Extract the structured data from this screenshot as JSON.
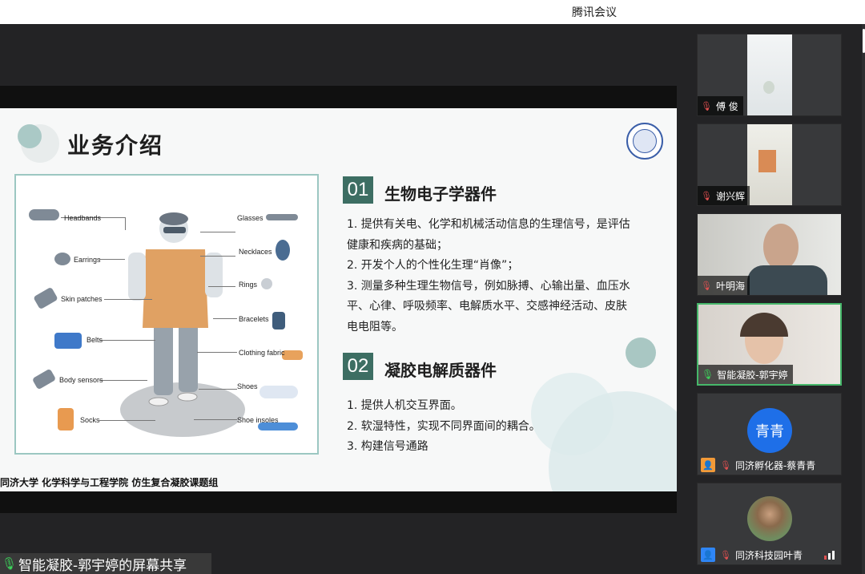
{
  "app": {
    "title": "腾讯会议"
  },
  "slide": {
    "title": "业务介绍",
    "footer": "同济大学 化学科学与工程学院 仿生复合凝胶课题组",
    "figure_labels": {
      "left": [
        "Headbands",
        "Earrings",
        "Skin patches",
        "Belts",
        "Body sensors",
        "Socks"
      ],
      "right": [
        "Glasses",
        "Necklaces",
        "Rings",
        "Bracelets",
        "Clothing fabric",
        "Shoes",
        "Shoe insoles"
      ]
    },
    "sections": [
      {
        "num": "01",
        "title": "生物电子学器件",
        "lines": [
          "1. 提供有关电、化学和机械活动信息的生理信号，是评估",
          "健康和疾病的基础；",
          "2. 开发个人的个性化生理“肖像”；",
          "3. 测量多种生理生物信号，例如脉搏、心输出量、血压水",
          "平、心律、呼吸频率、电解质水平、交感神经活动、皮肤",
          "电电阻等。"
        ]
      },
      {
        "num": "02",
        "title": "凝胶电解质器件",
        "lines": [
          "1.   提供人机交互界面。",
          "2.   软湿特性，实现不同界面间的耦合。",
          "3.   构建信号通路"
        ]
      }
    ]
  },
  "share_banner": "智能凝胶-郭宇婷的屏幕共享",
  "participants": [
    {
      "name": "傅  俊",
      "mic": "off",
      "video": "room"
    },
    {
      "name": "谢兴辉",
      "mic": "off",
      "video": "office"
    },
    {
      "name": "叶明海",
      "mic": "off",
      "video": "man"
    },
    {
      "name": "智能凝胶-郭宇婷",
      "mic": "on",
      "video": "woman",
      "active": true
    },
    {
      "name": "同济孵化器-蔡青青",
      "mic": "off",
      "video": "none",
      "avatar_text": "青青",
      "badge_color": "#f29a38"
    },
    {
      "name": "同济科技园叶青",
      "mic": "off",
      "video": "photo",
      "badge_color": "#2f86f6",
      "signal": true
    }
  ],
  "colors": {
    "section_badge": "#3d6e63",
    "active_border": "#46b76a",
    "avatar_blue": "#1e6fe8"
  }
}
